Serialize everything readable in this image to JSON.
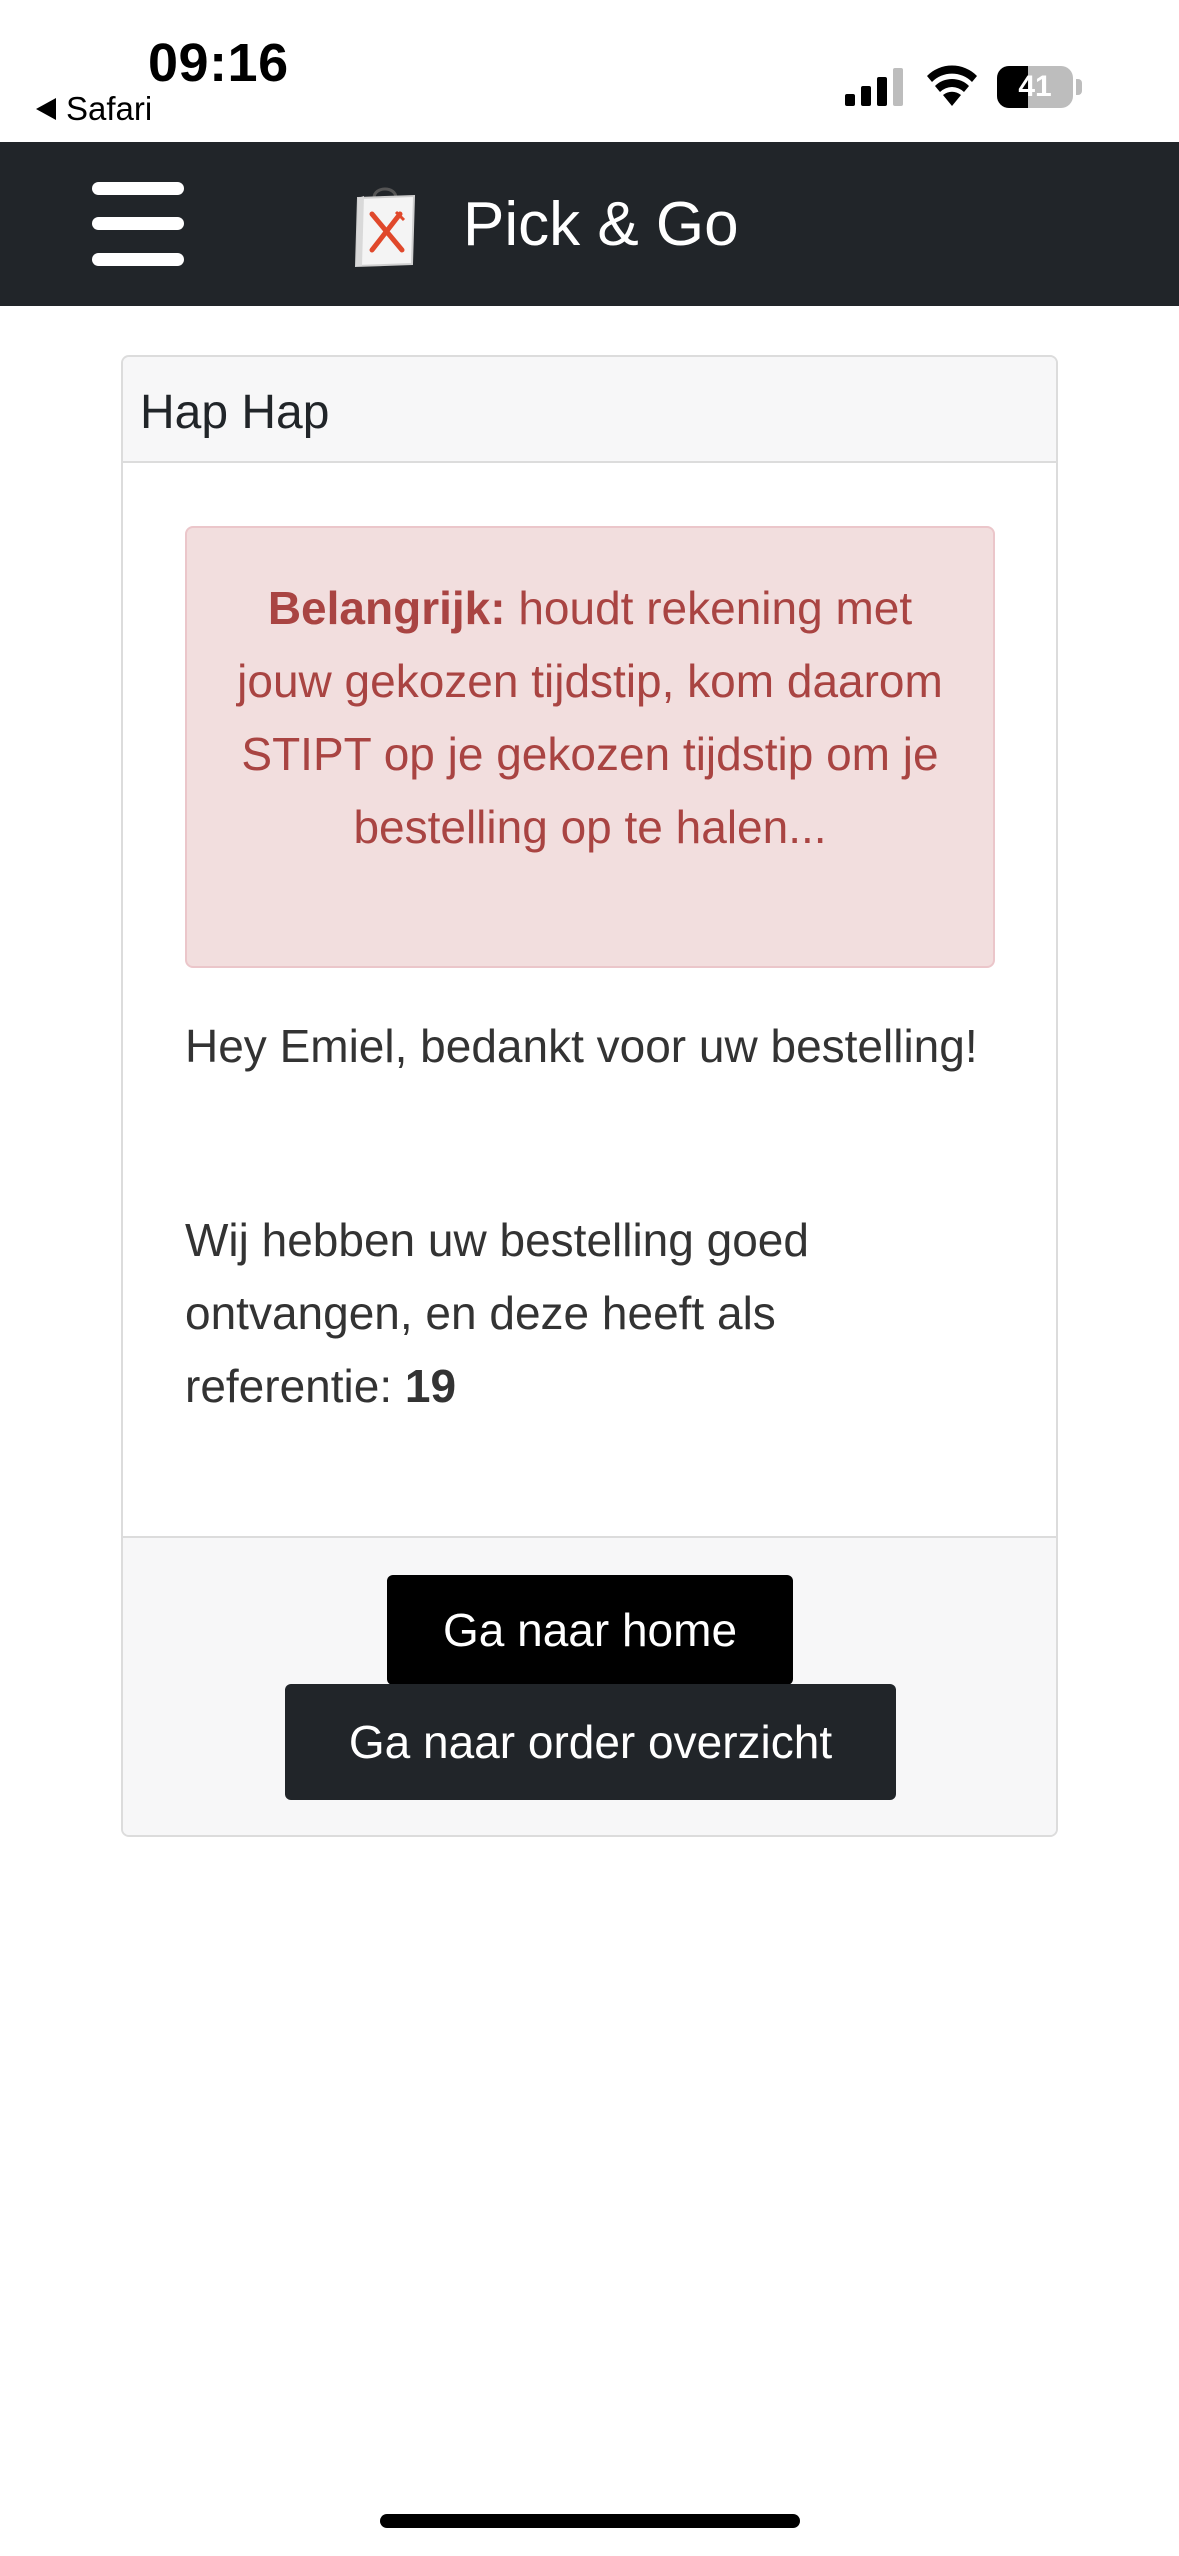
{
  "status_bar": {
    "time": "09:16",
    "back_app": "Safari",
    "battery_level": "41",
    "battery_fraction": 0.41
  },
  "navbar": {
    "brand": "Pick & Go",
    "menu_icon": "hamburger-menu-icon",
    "logo_icon": "shopping-bag-utensils-logo"
  },
  "card": {
    "title": "Hap Hap",
    "alert": {
      "strong": "Belangrijk:",
      "text": " houdt rekening met jouw gekozen tijdstip, kom daarom STIPT op je gekozen tijdstip om je bestelling op te halen..."
    },
    "thanks": "Hey Emiel, bedankt voor uw bestelling!",
    "reference_text": "Wij hebben uw bestelling goed ontvangen, en deze heeft als referentie: ",
    "reference_number": "19"
  },
  "buttons": {
    "home": "Ga naar home",
    "orders": "Ga naar order overzicht"
  },
  "colors": {
    "navbar_bg": "#212529",
    "alert_bg": "#f2dede",
    "alert_text": "#a94442",
    "logo_accent": "#e0482b"
  }
}
